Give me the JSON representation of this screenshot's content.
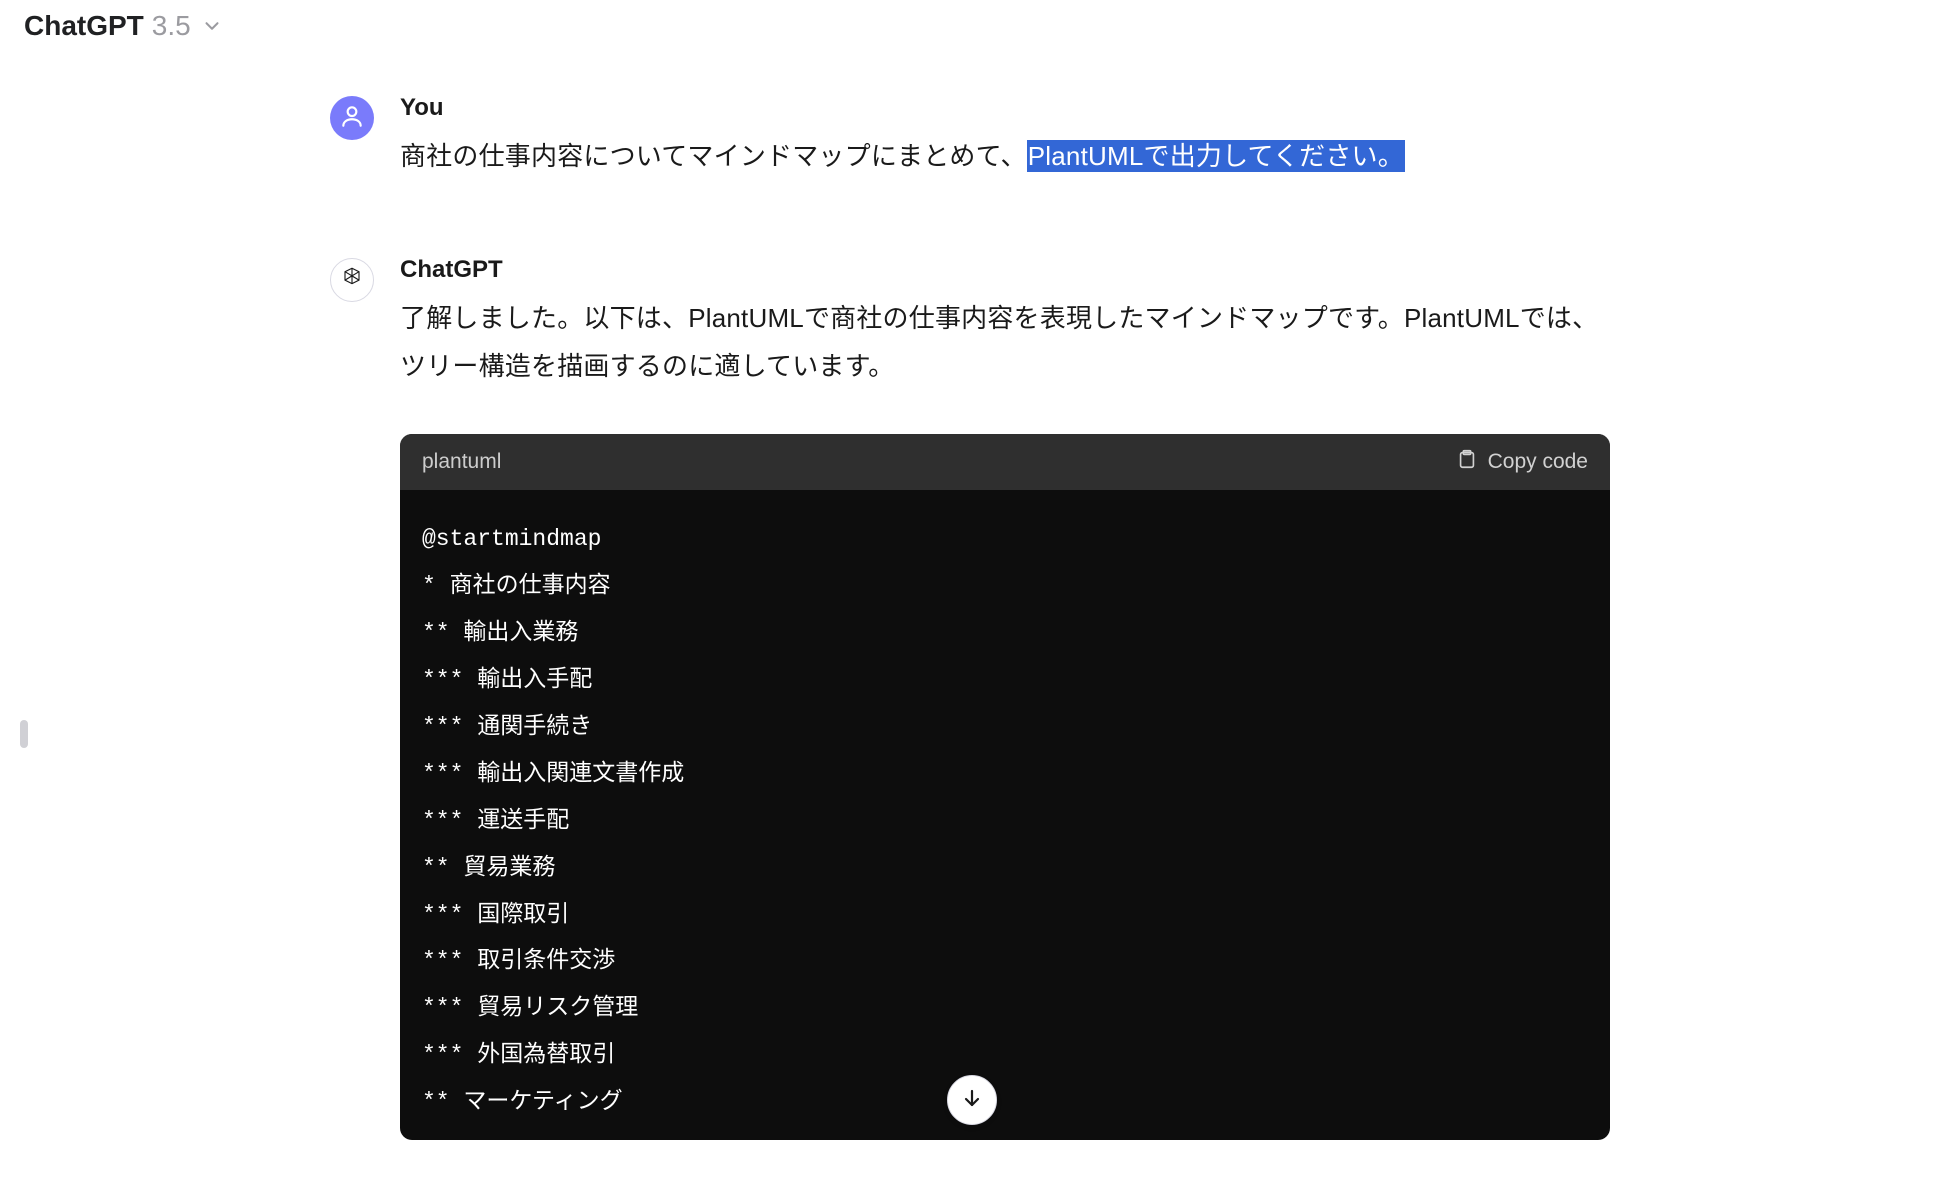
{
  "header": {
    "title": "ChatGPT",
    "version": "3.5"
  },
  "user": {
    "author": "You",
    "text_before_highlight": "商社の仕事内容についてマインドマップにまとめて、",
    "text_highlight": "PlantUMLで出力してください。"
  },
  "assistant": {
    "author": "ChatGPT",
    "text": "了解しました。以下は、PlantUMLで商社の仕事内容を表現したマインドマップです。PlantUMLでは、ツリー構造を描画するのに適しています。"
  },
  "code": {
    "lang": "plantuml",
    "copy_label": "Copy code",
    "content": "@startmindmap\n* 商社の仕事内容\n** 輸出入業務\n*** 輸出入手配\n*** 通関手続き\n*** 輸出入関連文書作成\n*** 運送手配\n** 貿易業務\n*** 国際取引\n*** 取引条件交渉\n*** 貿易リスク管理\n*** 外国為替取引\n** マーケティング"
  }
}
